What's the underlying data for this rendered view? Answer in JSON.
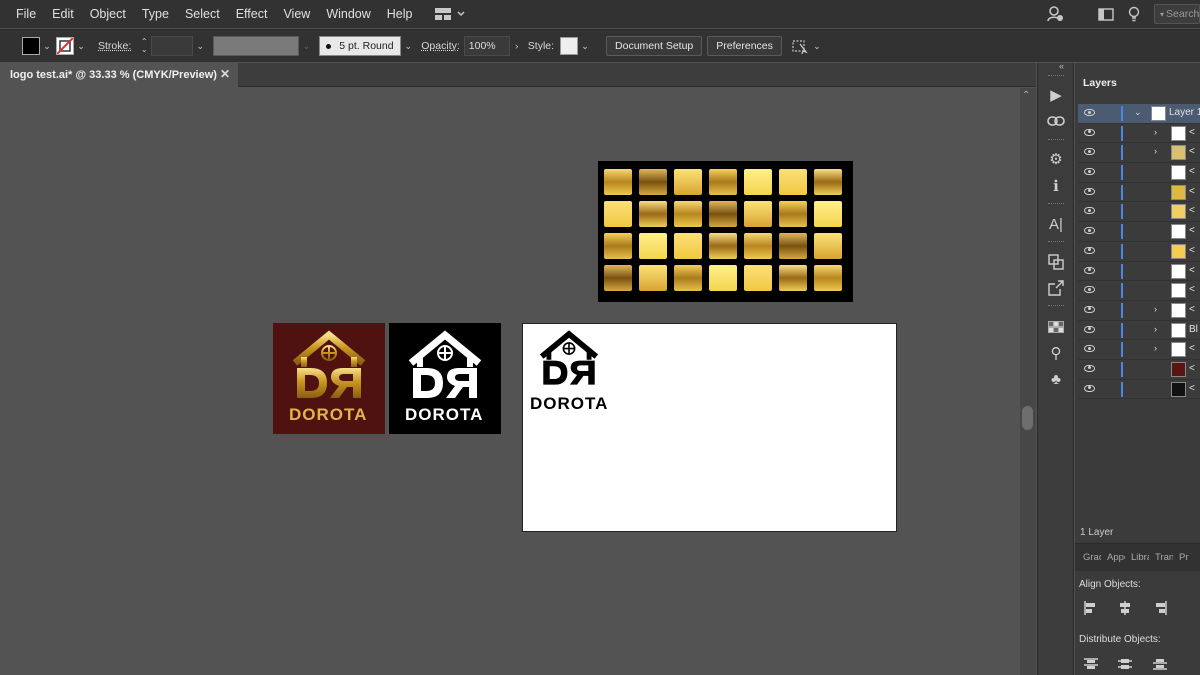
{
  "menubar": {
    "items": [
      "File",
      "Edit",
      "Object",
      "Type",
      "Select",
      "Effect",
      "View",
      "Window",
      "Help"
    ],
    "search_placeholder": "Search"
  },
  "controlbar": {
    "stroke_label": "Stroke:",
    "brush_label": "5 pt. Round",
    "opacity_label": "Opacity:",
    "opacity_value": "100%",
    "style_label": "Style:",
    "document_setup_label": "Document Setup",
    "preferences_label": "Preferences"
  },
  "document": {
    "tab_title": "logo test.ai* @ 33.33 % (CMYK/Preview)"
  },
  "artwork": {
    "logo_monogram": "DR",
    "logo_name": "DOROTA",
    "colors": {
      "maroon_bg": "#4f1210",
      "gold": "#d4a017",
      "light_gold": "#f2d463"
    }
  },
  "layers_panel": {
    "tab_label": "Layers",
    "rows": [
      {
        "name": "Layer 1",
        "selected": true,
        "expanded": true
      },
      {
        "name": "<",
        "expandable": true
      },
      {
        "name": "<",
        "expandable": true
      },
      {
        "name": "<"
      },
      {
        "name": "<"
      },
      {
        "name": "<"
      },
      {
        "name": "<"
      },
      {
        "name": "<"
      },
      {
        "name": "<"
      },
      {
        "name": "<"
      },
      {
        "name": "<",
        "expandable": true
      },
      {
        "name": "Bl",
        "expandable": true
      },
      {
        "name": "<",
        "expandable": true
      },
      {
        "name": "<"
      },
      {
        "name": "<"
      }
    ],
    "footer": "1 Layer"
  },
  "bottom_panel": {
    "tabs": [
      "Grad",
      "Appe",
      "Libra",
      "Tran",
      "Pr"
    ],
    "align_objects_label": "Align Objects:",
    "distribute_objects_label": "Distribute Objects:"
  }
}
